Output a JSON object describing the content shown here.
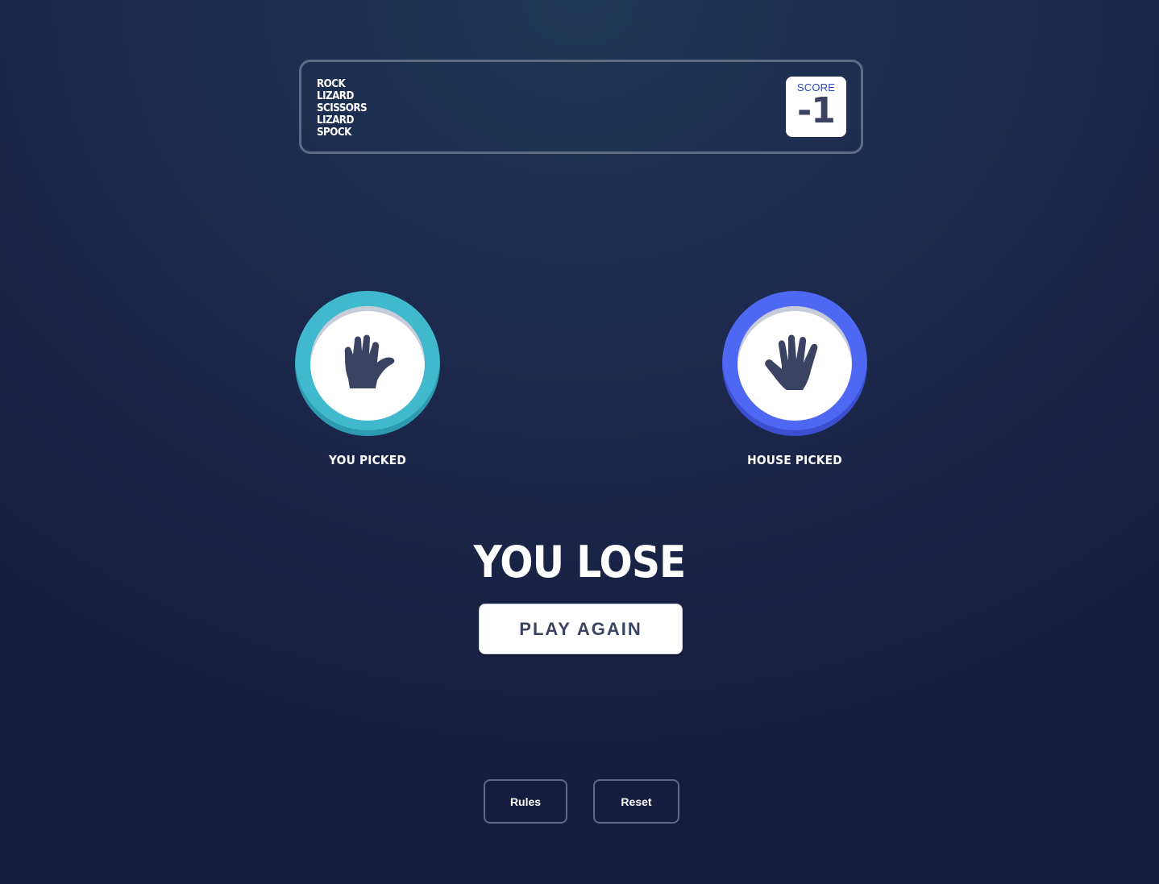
{
  "header": {
    "names": [
      "Rock",
      "Lizard",
      "Scissors",
      "Lizard",
      "Spock"
    ],
    "score_label": "SCORE",
    "score_value": "-1"
  },
  "game": {
    "you_picked": {
      "label": "YOU PICKED",
      "choice": "spock",
      "icon": "spock-hand-icon",
      "ring_color": "#40b9ce"
    },
    "house_picked": {
      "label": "HOUSE PICKED",
      "choice": "paper",
      "icon": "paper-hand-icon",
      "ring_color": "#4f68f3"
    },
    "result_text": "YOU LOSE",
    "play_again_label": "PLAY AGAIN"
  },
  "footer": {
    "rules_label": "Rules",
    "reset_label": "Reset"
  }
}
